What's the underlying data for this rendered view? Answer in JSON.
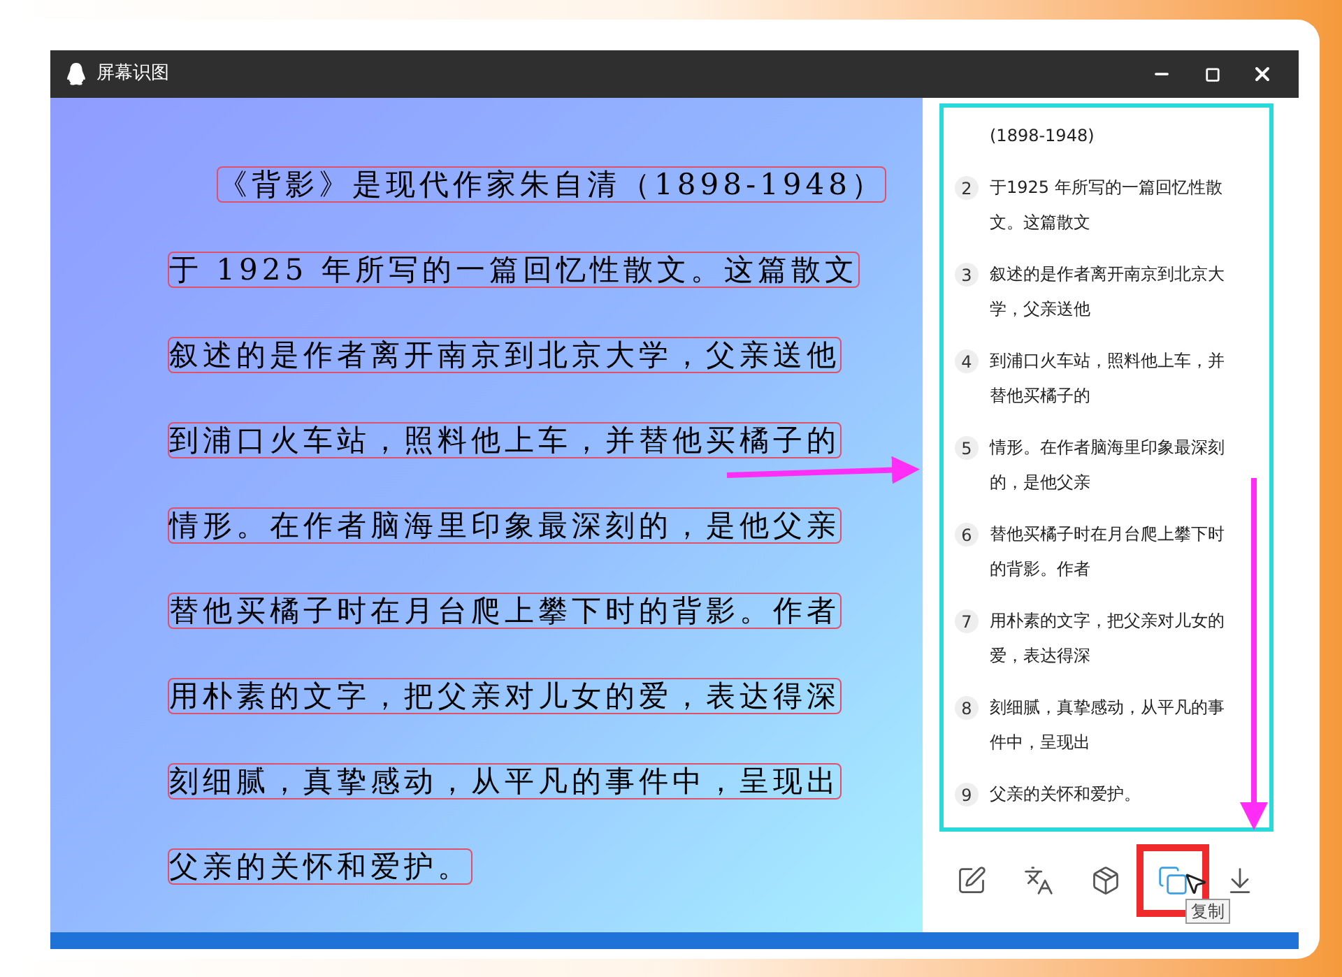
{
  "window": {
    "title": "屏幕识图"
  },
  "image_lines": [
    "《背影》是现代作家朱自清（1898-1948）",
    "于 1925 年所写的一篇回忆性散文。这篇散文",
    "叙述的是作者离开南京到北京大学，父亲送他",
    "到浦口火车站，照料他上车，并替他买橘子的",
    "情形。在作者脑海里印象最深刻的，是他父亲",
    "替他买橘子时在月台爬上攀下时的背影。作者",
    "用朴素的文字，把父亲对儿女的爱，表达得深",
    "刻细腻，真挚感动，从平凡的事件中，呈现出",
    "父亲的关怀和爱护。"
  ],
  "results": [
    {
      "text": "(1898-1948)"
    },
    {
      "number": "2",
      "text": "于1925 年所写的一篇回忆性散文。这篇散文"
    },
    {
      "number": "3",
      "text": "叙述的是作者离开南京到北京大学，父亲送他"
    },
    {
      "number": "4",
      "text": "到浦口火车站，照料他上车，并替他买橘子的"
    },
    {
      "number": "5",
      "text": "情形。在作者脑海里印象最深刻的，是他父亲"
    },
    {
      "number": "6",
      "text": "替他买橘子时在月台爬上攀下时的背影。作者"
    },
    {
      "number": "7",
      "text": "用朴素的文字，把父亲对儿女的爱，表达得深"
    },
    {
      "number": "8",
      "text": "刻细腻，真挚感动，从平凡的事件中，呈现出"
    },
    {
      "number": "9",
      "text": "父亲的关怀和爱护。"
    }
  ],
  "toolbar": {
    "tooltip": "复制"
  }
}
